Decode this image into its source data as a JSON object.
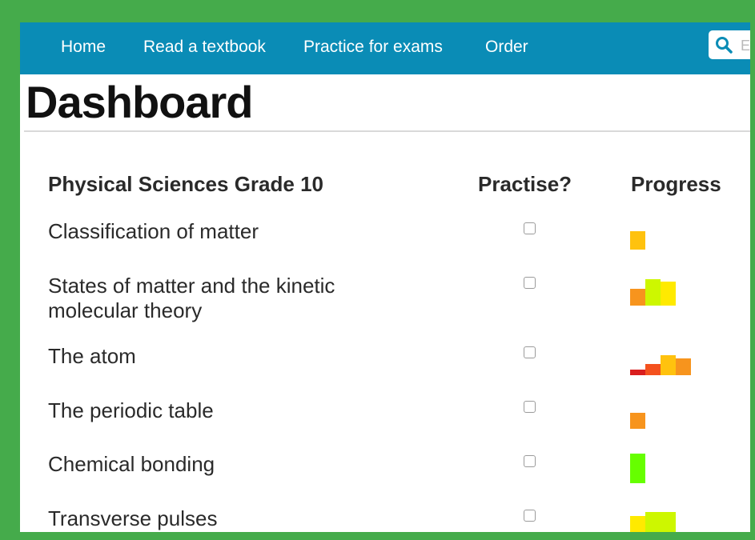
{
  "nav": {
    "items": [
      "Home",
      "Read a textbook",
      "Practice for exams",
      "Order"
    ],
    "search_placeholder": "E"
  },
  "page": {
    "title": "Dashboard"
  },
  "table": {
    "subject_header": "Physical Sciences Grade 10",
    "practise_header": "Practise?",
    "progress_header": "Progress",
    "rows": [
      {
        "topic": "Classification of matter",
        "practise": false
      },
      {
        "topic": "States of matter and the kinetic molecular theory",
        "practise": false
      },
      {
        "topic": "The atom",
        "practise": false
      },
      {
        "topic": "The periodic table",
        "practise": false
      },
      {
        "topic": "Chemical bonding",
        "practise": false
      },
      {
        "topic": "Transverse pulses",
        "practise": false
      }
    ]
  },
  "colors": {
    "frame": "#45ab4b",
    "navbar": "#0a8cb6",
    "progress_red": "#d91e1e",
    "progress_red_orange": "#f4511e",
    "progress_orange": "#f7941d",
    "progress_amber": "#ffc20e",
    "progress_yellow": "#ffea00",
    "progress_yellow_green": "#cdf700",
    "progress_green": "#66ff00"
  }
}
